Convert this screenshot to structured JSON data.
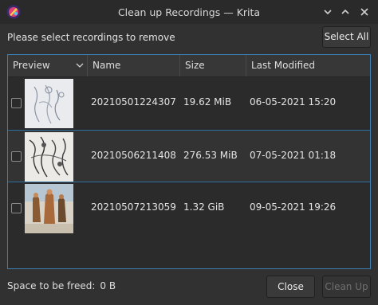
{
  "window": {
    "title": "Clean up Recordings — Krita",
    "controls": [
      "chevron-down-icon",
      "chevron-up-icon",
      "close-icon"
    ]
  },
  "prompt": "Please select recordings to remove",
  "select_all_label": "Select All",
  "table": {
    "columns": [
      "Preview",
      "Name",
      "Size",
      "Last Modified"
    ],
    "rows": [
      {
        "checked": false,
        "name": "20210501224307",
        "size": "19.62 MiB",
        "modified": "06-05-2021 15:20"
      },
      {
        "checked": false,
        "name": "20210506211408",
        "size": "276.53 MiB",
        "modified": "07-05-2021 01:18"
      },
      {
        "checked": false,
        "name": "20210507213059",
        "size": "1.32 GiB",
        "modified": "09-05-2021 19:26"
      }
    ]
  },
  "footer": {
    "freed_label": "Space to be freed:",
    "freed_value": "0 B",
    "close_label": "Close",
    "cleanup_label": "Clean Up",
    "cleanup_enabled": false
  },
  "colors": {
    "accent": "#3d7fb3",
    "background": "#313131"
  }
}
